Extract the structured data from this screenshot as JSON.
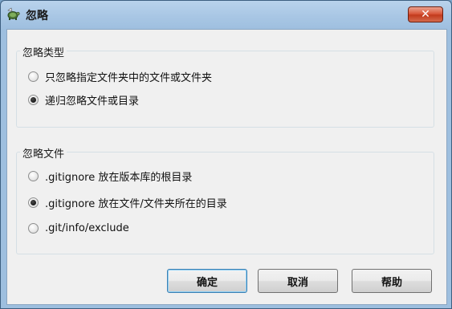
{
  "window": {
    "title": "忽略",
    "close_glyph": "✕"
  },
  "ignore_type": {
    "legend": "忽略类型",
    "options": [
      {
        "label": "只忽略指定文件夹中的文件或文件夹",
        "checked": false
      },
      {
        "label": "递归忽略文件或目录",
        "checked": true
      }
    ]
  },
  "ignore_file": {
    "legend": "忽略文件",
    "options": [
      {
        "label": ".gitignore 放在版本库的根目录",
        "checked": false
      },
      {
        "label": ".gitignore 放在文件/文件夹所在的目录",
        "checked": true
      },
      {
        "label": ".git/info/exclude",
        "checked": false
      }
    ]
  },
  "buttons": {
    "ok": "确定",
    "cancel": "取消",
    "help": "帮助"
  },
  "colors": {
    "title_bar": "#a8c6e4",
    "close_button": "#c9442a",
    "client_bg": "#f0f0f0",
    "default_button_border": "#3c7fb1"
  },
  "icons": {
    "app": "tortoise-git-icon",
    "close": "close-icon"
  }
}
